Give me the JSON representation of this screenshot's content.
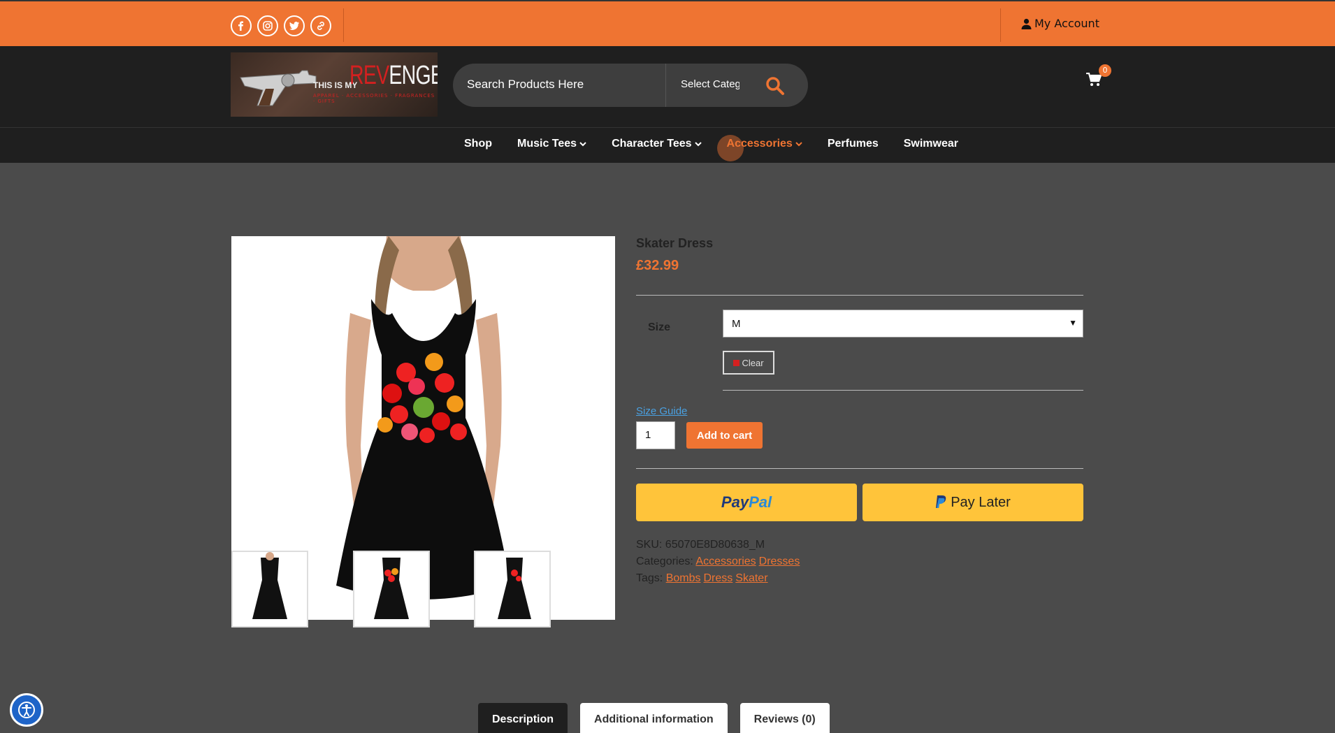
{
  "topbar": {
    "socials": [
      "facebook-icon",
      "instagram-icon",
      "twitter-icon",
      "link-icon"
    ],
    "account_label": "My Account"
  },
  "header": {
    "logo": {
      "small": "THIS IS MY",
      "big_red": "REV",
      "big_rest": "ENGE",
      "tagline": "APPAREL · ACCESSORIES · FRAGRANCES · GIFTS"
    },
    "search": {
      "placeholder": "Search Products Here",
      "category": "Select Category"
    },
    "cart_count": "0"
  },
  "nav": {
    "items": [
      {
        "label": "Shop",
        "dropdown": false
      },
      {
        "label": "Music Tees",
        "dropdown": true
      },
      {
        "label": "Character Tees",
        "dropdown": true
      },
      {
        "label": "Accessories",
        "dropdown": true,
        "active": true
      },
      {
        "label": "Perfumes",
        "dropdown": false
      },
      {
        "label": "Swimwear",
        "dropdown": false
      }
    ]
  },
  "product": {
    "title": "Skater Dress",
    "price": "£32.99",
    "size_label": "Size",
    "size_value": "M",
    "clear_label": "Clear",
    "size_guide": "Size Guide",
    "qty": "1",
    "add_to_cart": "Add to cart",
    "paypal_a": "Pay",
    "paypal_b": "Pal",
    "pay_later": "Pay Later",
    "sku_label": "SKU:",
    "sku": "65070E8D80638_M",
    "categories_label": "Categories:",
    "categories": [
      "Accessories",
      "Dresses"
    ],
    "tags_label": "Tags:",
    "tags": [
      "Bombs",
      "Dress",
      "Skater"
    ]
  },
  "tabs": [
    "Description",
    "Additional information",
    "Reviews (0)"
  ],
  "colors": {
    "accent": "#ef7432",
    "dark": "#1f1f1f",
    "page_bg": "#4b4b4b",
    "paypal": "#ffc43a"
  }
}
